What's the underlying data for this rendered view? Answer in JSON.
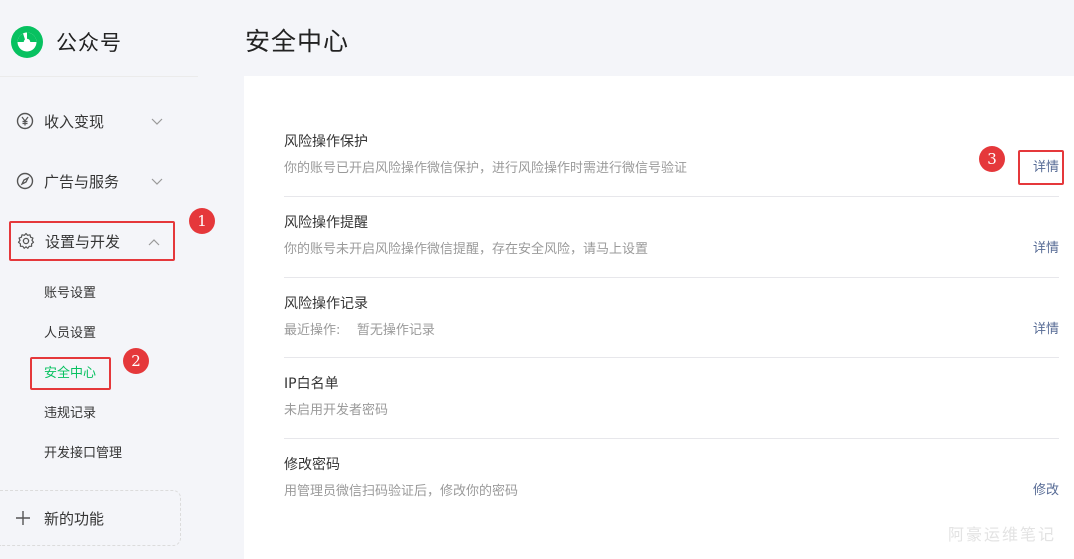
{
  "brand": {
    "name": "公众号",
    "logo_icon": "wechat-official-account-logo"
  },
  "colors": {
    "accent_green": "#07c160",
    "link_blue": "#576b95",
    "annotation_red": "#e5383b"
  },
  "sidebar": {
    "items": [
      {
        "label": "收入变现",
        "icon": "yen-circle-icon"
      },
      {
        "label": "广告与服务",
        "icon": "compass-icon"
      },
      {
        "label": "设置与开发",
        "icon": "gear-icon"
      }
    ],
    "sub_items": [
      {
        "label": "账号设置"
      },
      {
        "label": "人员设置"
      },
      {
        "label": "安全中心"
      },
      {
        "label": "违规记录"
      },
      {
        "label": "开发接口管理"
      }
    ],
    "new_feature": {
      "label": "新的功能",
      "icon": "plus-icon"
    }
  },
  "annotations": {
    "step1": "1",
    "step2": "2",
    "step3": "3"
  },
  "main": {
    "title": "安全中心",
    "rows": [
      {
        "title": "风险操作保护",
        "desc": "你的账号已开启风险操作微信保护，进行风险操作时需进行微信号验证",
        "action": "详情"
      },
      {
        "title": "风险操作提醒",
        "desc": "你的账号未开启风险操作微信提醒，存在安全风险，请马上设置",
        "action": "详情"
      },
      {
        "title": "风险操作记录",
        "desc": "最近操作:    暂无操作记录",
        "action": "详情"
      },
      {
        "title": "IP白名单",
        "desc": "未启用开发者密码",
        "action": ""
      },
      {
        "title": "修改密码",
        "desc": "用管理员微信扫码验证后，修改你的密码",
        "action": "修改"
      }
    ]
  },
  "watermark": "阿豪运维笔记"
}
